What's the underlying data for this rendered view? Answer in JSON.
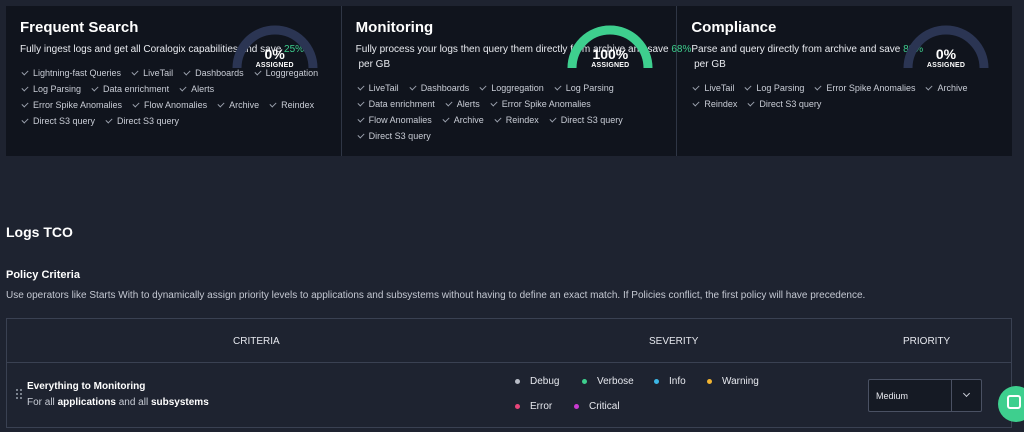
{
  "colors": {
    "accent": "#3ecf8e",
    "gauge_track": "#2b3553",
    "card_bg": "#10141d",
    "page_bg": "#1e2330"
  },
  "plans": [
    {
      "title": "Frequent Search",
      "desc_pre": "Fully ingest logs and get all Coralogix capabilities and save ",
      "desc_pct": "25%",
      "desc_post": "",
      "gauge_percent": 0,
      "gauge_value": "0%",
      "gauge_label": "ASSIGNED",
      "features": [
        "Lightning-fast Queries",
        "LiveTail",
        "Dashboards",
        "Loggregation",
        "Log Parsing",
        "Data enrichment",
        "Alerts",
        "Error Spike Anomalies",
        "Flow Anomalies",
        "Archive",
        "Reindex",
        "Direct S3 query",
        "Direct S3 query"
      ]
    },
    {
      "title": "Monitoring",
      "desc_pre": "Fully process your logs then query them directly from archive and save ",
      "desc_pct": "68%",
      "desc_post": " per GB",
      "gauge_percent": 100,
      "gauge_value": "100%",
      "gauge_label": "ASSIGNED",
      "features": [
        "LiveTail",
        "Dashboards",
        "Loggregation",
        "Log Parsing",
        "Data enrichment",
        "Alerts",
        "Error Spike Anomalies",
        "Flow Anomalies",
        "Archive",
        "Reindex",
        "Direct S3 query",
        "Direct S3 query"
      ]
    },
    {
      "title": "Compliance",
      "desc_pre": "Parse and query directly from archive and save ",
      "desc_pct": "88%",
      "desc_post": " per GB",
      "gauge_percent": 0,
      "gauge_value": "0%",
      "gauge_label": "ASSIGNED",
      "features": [
        "LiveTail",
        "Log Parsing",
        "Error Spike Anomalies",
        "Archive",
        "Reindex",
        "Direct S3 query"
      ]
    }
  ],
  "section": {
    "title": "Logs TCO"
  },
  "policy": {
    "title": "Policy Criteria",
    "description": "Use operators like Starts With to dynamically assign priority levels to applications and subsystems without having to define an exact match. If Policies conflict, the first policy will have precedence."
  },
  "table": {
    "headers": {
      "criteria": "CRITERIA",
      "severity": "SEVERITY",
      "priority": "PRIORITY"
    },
    "row": {
      "name": "Everything to Monitoring",
      "desc": {
        "prefix": "For all ",
        "apps": "applications",
        "mid": " and all ",
        "subs": "subsystems"
      },
      "severities": [
        {
          "label": "Debug",
          "color": "#b8bcc6"
        },
        {
          "label": "Verbose",
          "color": "#3ecf8e"
        },
        {
          "label": "Info",
          "color": "#3cb7e6"
        },
        {
          "label": "Warning",
          "color": "#f2b431"
        },
        {
          "label": "Error",
          "color": "#e8457a"
        },
        {
          "label": "Critical",
          "color": "#c93ad0"
        }
      ],
      "priority": "Medium"
    }
  }
}
